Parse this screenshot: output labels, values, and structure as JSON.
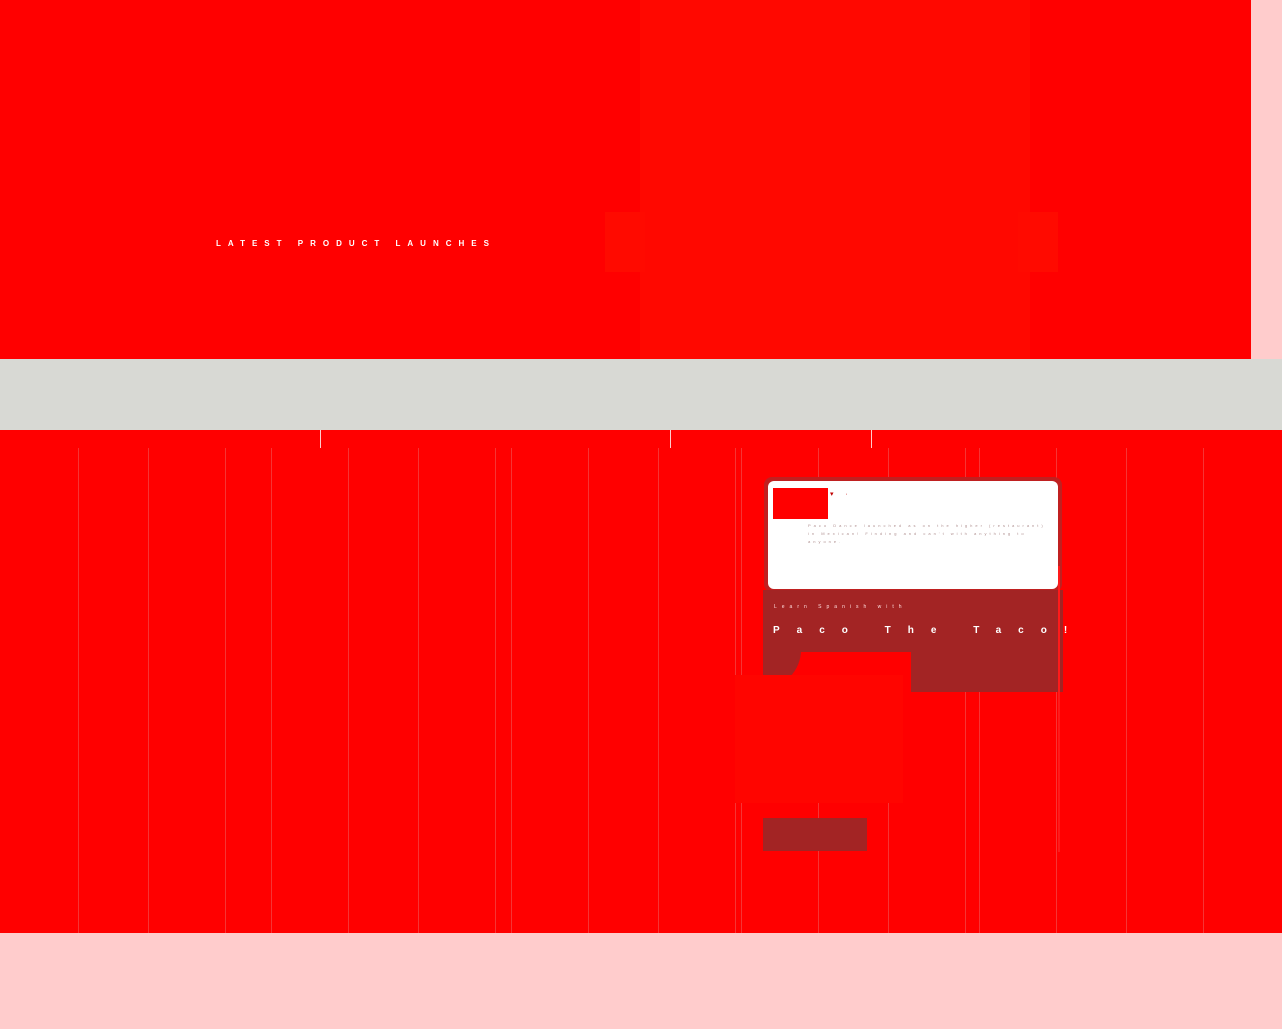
{
  "colors": {
    "primary_red": "#ff0000",
    "dark_red": "#a32424",
    "band_grey": "#d8d9d4",
    "page_pink": "#ffcccc",
    "white": "#ffffff"
  },
  "hero": {
    "title": "LATEST PRODUCT LAUNCHES",
    "body": ""
  },
  "intro": {
    "heading": "",
    "body": ""
  },
  "product_card": {
    "description": "Paco Dance launched as on the higher (restaurant) in Mexican! Finding and can't with anything to anyone.",
    "promo_subtitle": "Learn Spanish with",
    "promo_title": "Paco The Taco!",
    "cta_label": ""
  }
}
